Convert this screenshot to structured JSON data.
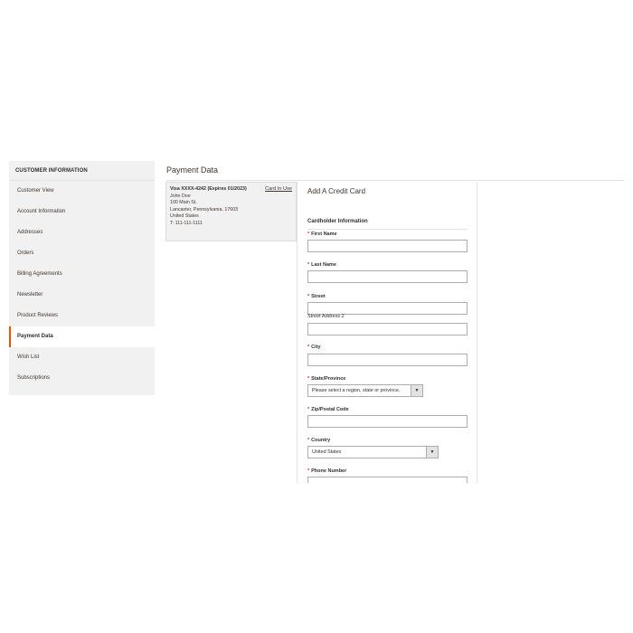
{
  "sidebar": {
    "title": "CUSTOMER INFORMATION",
    "items": [
      {
        "label": "Customer View"
      },
      {
        "label": "Account Information"
      },
      {
        "label": "Addresses"
      },
      {
        "label": "Orders"
      },
      {
        "label": "Billing Agreements"
      },
      {
        "label": "Newsletter"
      },
      {
        "label": "Product Reviews"
      },
      {
        "label": "Payment Data",
        "active": true
      },
      {
        "label": "Wish List"
      },
      {
        "label": "Subscriptions"
      }
    ]
  },
  "page": {
    "title": "Payment Data"
  },
  "stored_card": {
    "title": "Visa XXXX-4242",
    "expires": "(Expires 01/2023)",
    "status_link": "Card In Use",
    "name": "John Doe",
    "street": "100 Main St.",
    "city_line": "Lancaster, Pennsylvania, 17603",
    "country": "United States",
    "phone": "T: 111-111-1111"
  },
  "form": {
    "title": "Add A Credit Card",
    "section_title": "Cardholder Information",
    "required_marker": "*",
    "first_name_label": "First Name",
    "last_name_label": "Last Name",
    "street_label": "Street",
    "street2_label": "Street Address 2",
    "city_label": "City",
    "state_label": "State/Province",
    "state_value": "Please select a region, state or province.",
    "zip_label": "Zip/Postal Code",
    "country_label": "Country",
    "country_value": "United States",
    "phone_label": "Phone Number"
  },
  "icons": {
    "select_arrow": "chevron-down-icon"
  },
  "colors": {
    "accent": "#eb5202",
    "required": "#e22626",
    "sidebar_bg": "#f1f1f1"
  }
}
